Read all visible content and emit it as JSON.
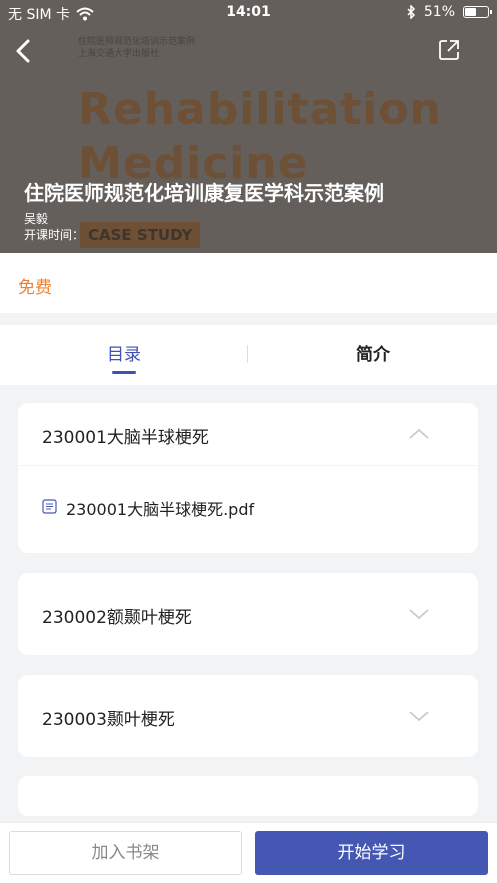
{
  "status_bar": {
    "carrier": "无 SIM 卡",
    "time": "14:01",
    "battery": "51%",
    "battery_level": 0.51
  },
  "cover": {
    "word1": "Rehabilitation",
    "word2": "Medicine",
    "badge": "CASE STUDY",
    "small1": "住院医师规范化培训示范案例",
    "small2": "上海交通大学出版社"
  },
  "course": {
    "title": "住院医师规范化培训康复医学科示范案例",
    "author": "吴毅",
    "start_time_label": "开课时间："
  },
  "price": "免费",
  "tabs": [
    {
      "label": "目录",
      "active": true
    },
    {
      "label": "简介",
      "active": false
    }
  ],
  "chapters": [
    {
      "title": "230001大脑半球梗死",
      "expanded": true,
      "files": [
        "230001大脑半球梗死.pdf"
      ]
    },
    {
      "title": "230002额颞叶梗死",
      "expanded": false
    },
    {
      "title": "230003颞叶梗死",
      "expanded": false
    }
  ],
  "bottom": {
    "shelf_label": "加入书架",
    "start_label": "开始学习"
  },
  "colors": {
    "accent": "#3f51b5",
    "start_button": "#4457b2",
    "price": "#f0802f"
  },
  "icons": [
    "back-icon",
    "share-icon",
    "wifi-icon",
    "bluetooth-icon",
    "battery-icon",
    "chevron-up-icon",
    "chevron-down-icon",
    "document-icon"
  ]
}
